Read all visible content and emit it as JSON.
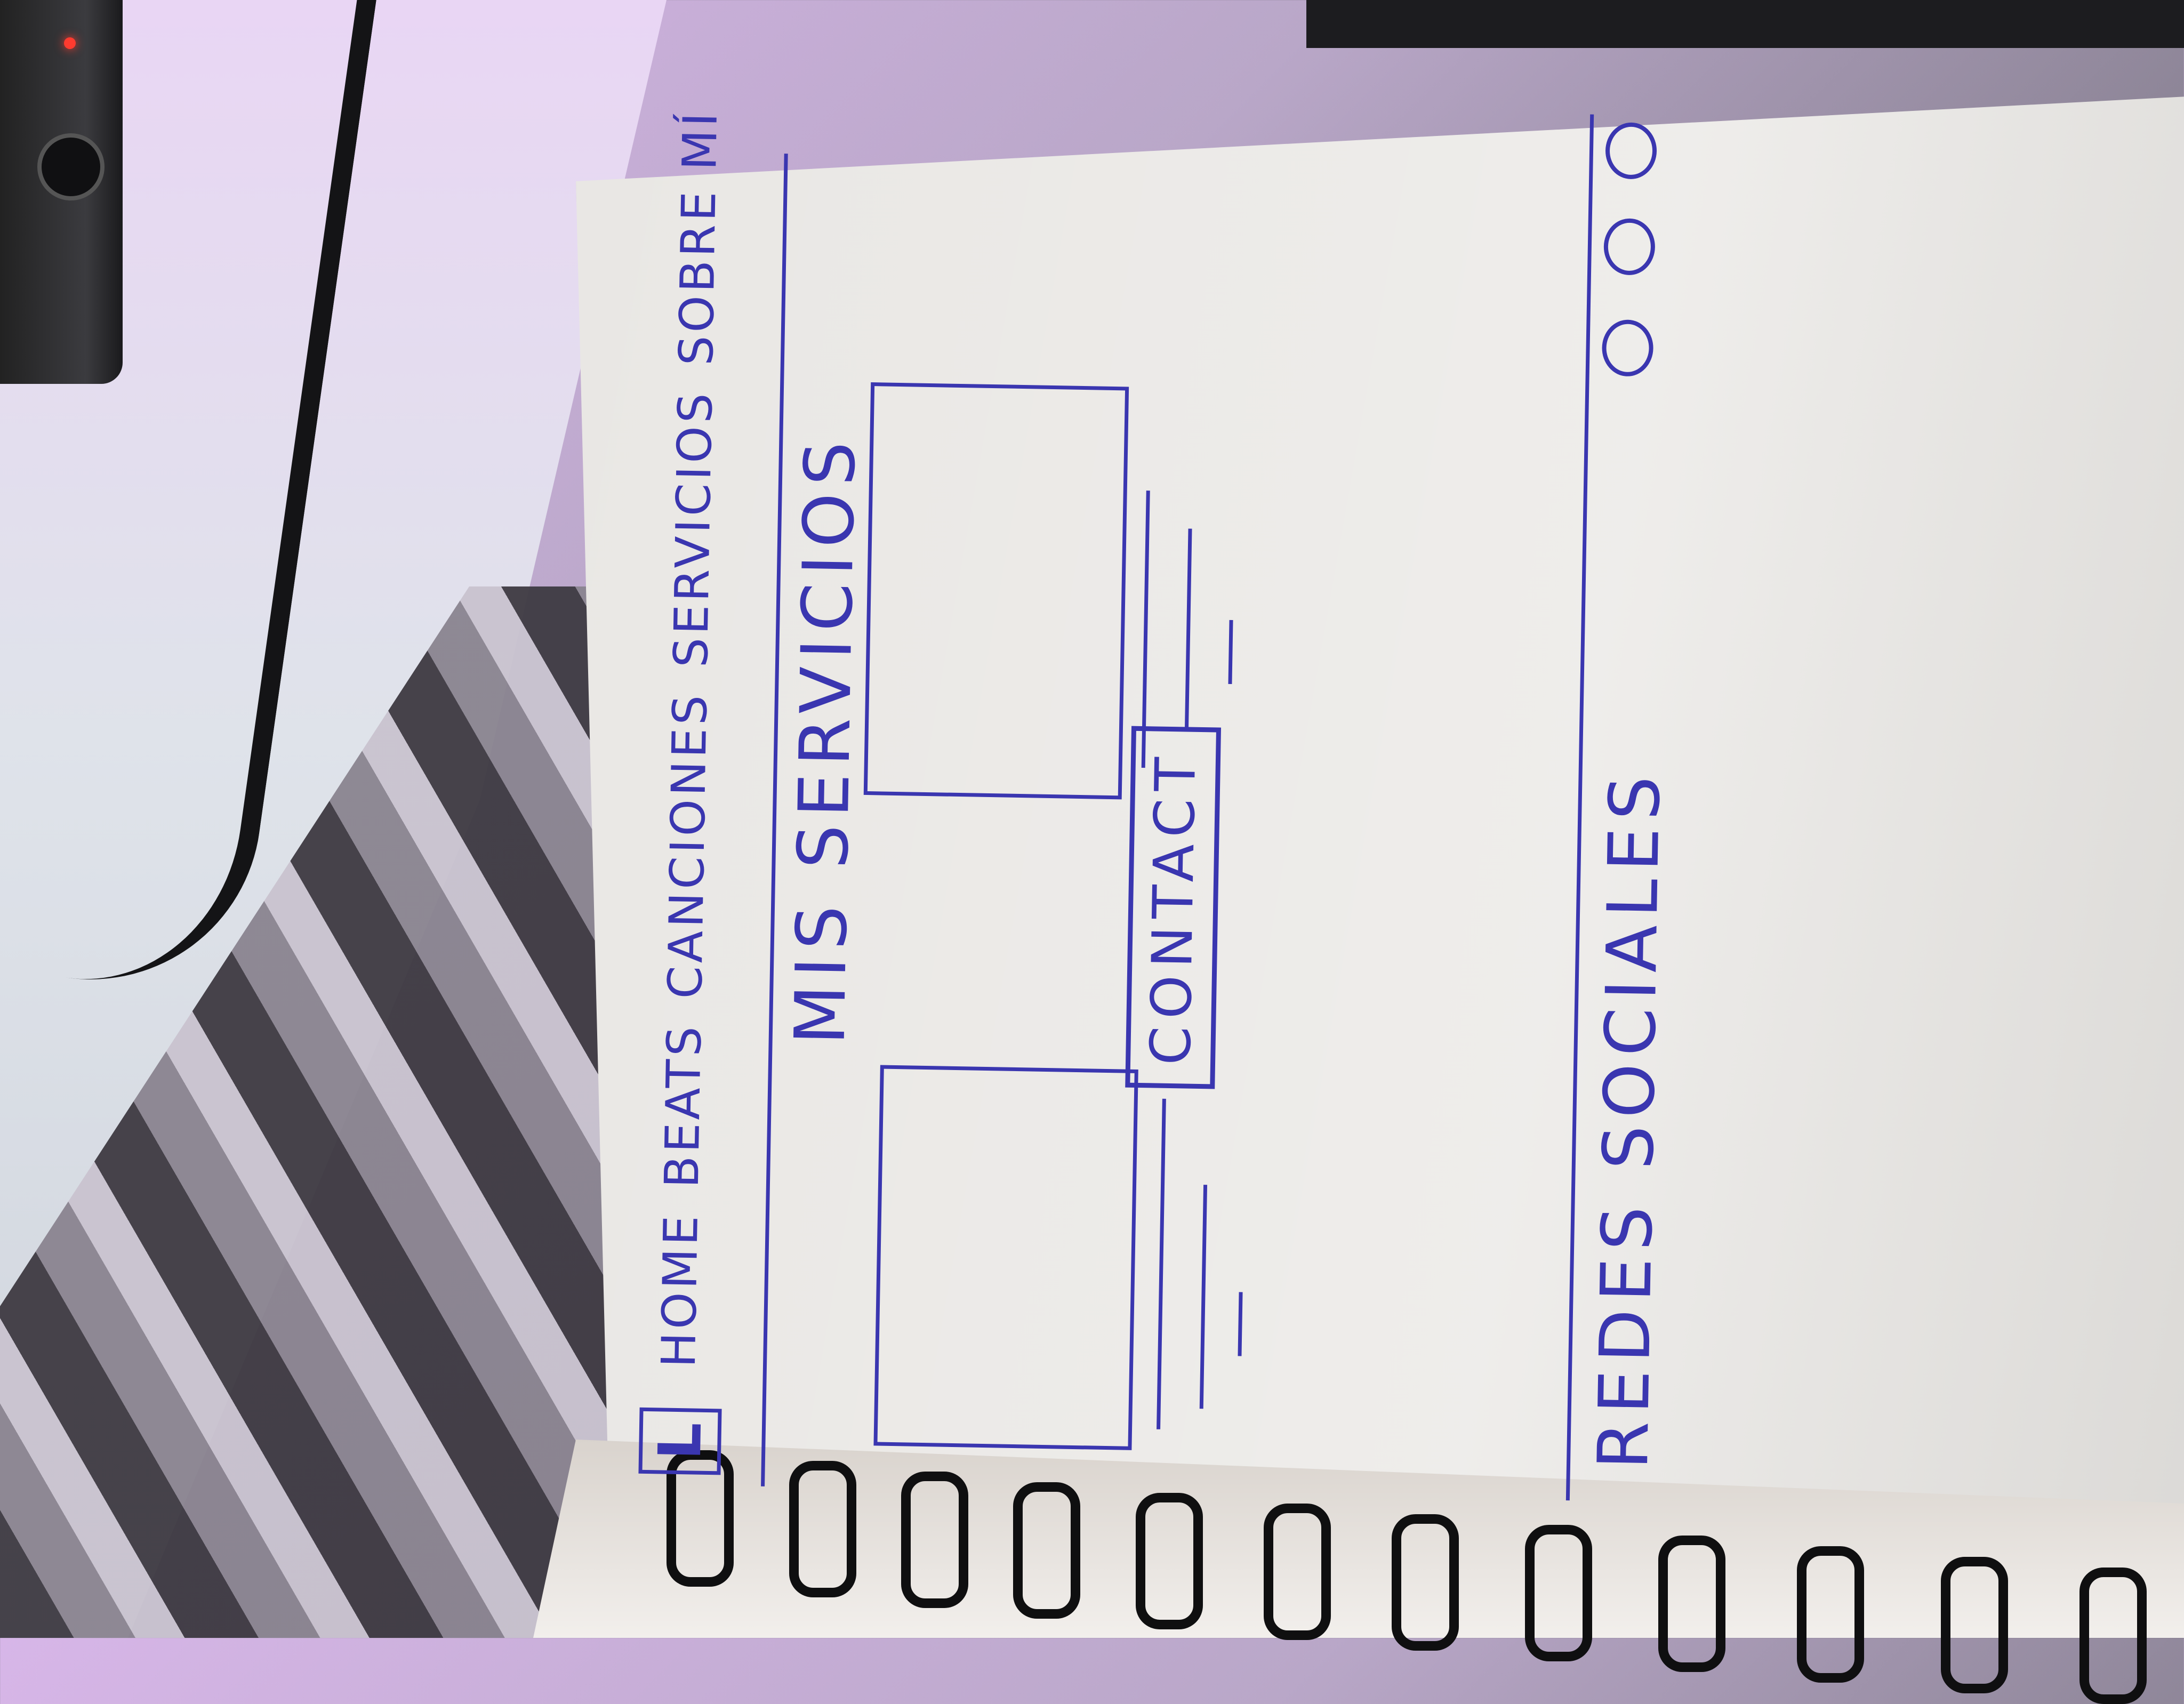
{
  "header": {
    "logo_letter": "L",
    "nav": [
      "HOME",
      "BEATS",
      "CANCIONES",
      "SERVICIOS",
      "SOBRE MÍ"
    ]
  },
  "main": {
    "section_title": "MIS SERVICIOS",
    "services": [
      {
        "image": "image-placeholder",
        "text_lines": 3
      },
      {
        "image": "image-placeholder",
        "text_lines": 3
      }
    ],
    "contact_label": "CONTACT"
  },
  "footer": {
    "title": "REDES SOCIALES",
    "social_icons": [
      "social-icon",
      "social-icon",
      "social-icon"
    ]
  },
  "colors": {
    "ink": "#3a36b0",
    "paper": "#e9e7e4"
  }
}
